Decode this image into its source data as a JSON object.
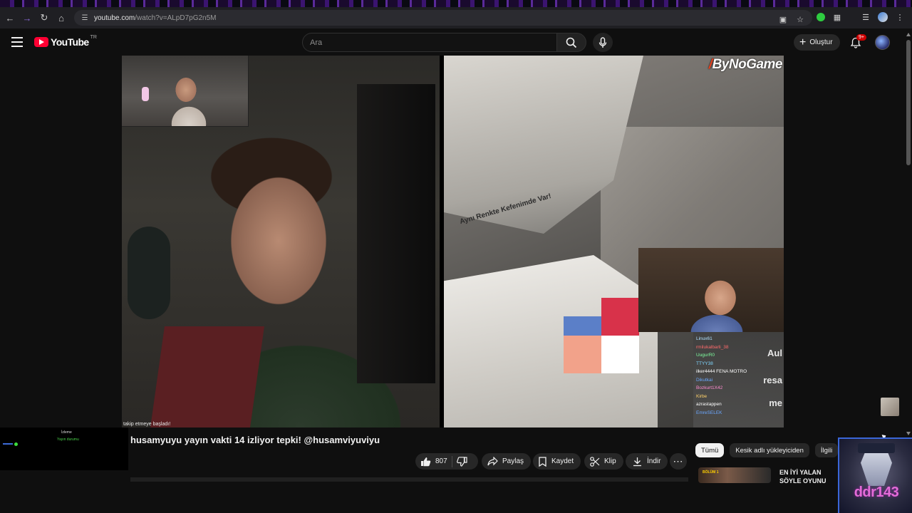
{
  "browser": {
    "url_host": "youtube.com",
    "url_path": "/watch?v=ALpD7pG2n5M"
  },
  "masthead": {
    "logo_text": "YouTube",
    "country_code": "TR",
    "search_placeholder": "Ara",
    "create_label": "Oluştur",
    "notification_badge": "9+"
  },
  "player": {
    "follow_overlay": "takip etmeye başladı!",
    "brand_label": "ByNoGame",
    "trunk_text": "Aynı Renkte Kefenimde Var!",
    "logo_colors": [
      "#d8324a",
      "#5b7fc8",
      "#f2a28a",
      "#ffffff"
    ],
    "chat_lines": [
      {
        "text": "Linux61",
        "color": "#b0e0ff"
      },
      {
        "text": "rmilukalbarli_38",
        "color": "#ff6b6b"
      },
      {
        "text": "UugurR0",
        "color": "#7fffa0"
      },
      {
        "text": "TTYY38",
        "color": "#7fd7ff"
      },
      {
        "text": "ilker4444  FENA MOTRO",
        "color": "#ffffff"
      },
      {
        "text": "Dikutkai",
        "color": "#6aa8ff"
      },
      {
        "text": "Bozkurt1X42",
        "color": "#ff8bd0"
      },
      {
        "text": "Kirbe",
        "color": "#ffd16a"
      },
      {
        "text": "azrastappen",
        "color": "#ffffff"
      },
      {
        "text": "EmreSELEK",
        "color": "#6aa8ff"
      }
    ],
    "chat_big": [
      "Aul",
      "resa",
      "me"
    ]
  },
  "left_mini": {
    "line1": "İzleme",
    "line2": "Yayın durumu"
  },
  "video": {
    "title": "husamyuyu yayın vakti 14 izliyor tepki! @husamviyuviyu",
    "like_count": "807",
    "share_label": "Paylaş",
    "save_label": "Kaydet",
    "clip_label": "Klip",
    "download_label": "İndir"
  },
  "chips": [
    "Tümü",
    "Kesik adlı yükleyiciden",
    "İlgili"
  ],
  "recommended": {
    "thumb_label": "BÖLÜM 1",
    "title": "EN İYİ YALAN SÖYLE OYUNU KAZANIRLI SE"
  },
  "channel_art": {
    "name": "ddr143"
  }
}
